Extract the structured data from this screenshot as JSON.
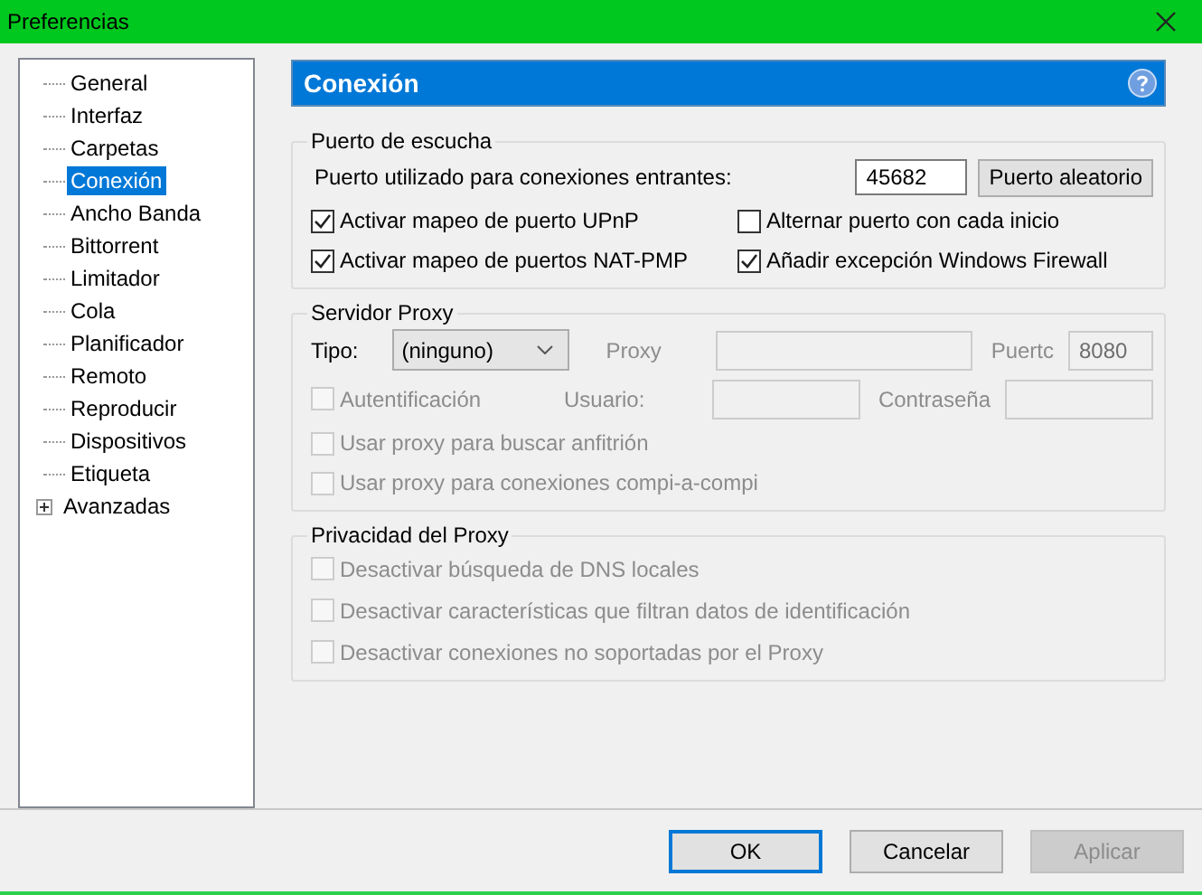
{
  "window": {
    "title": "Preferencias"
  },
  "tree": [
    {
      "label": "General",
      "selected": false,
      "expandable": false
    },
    {
      "label": "Interfaz",
      "selected": false,
      "expandable": false
    },
    {
      "label": "Carpetas",
      "selected": false,
      "expandable": false
    },
    {
      "label": "Conexión",
      "selected": true,
      "expandable": false
    },
    {
      "label": "Ancho Banda",
      "selected": false,
      "expandable": false
    },
    {
      "label": "Bittorrent",
      "selected": false,
      "expandable": false
    },
    {
      "label": "Limitador",
      "selected": false,
      "expandable": false
    },
    {
      "label": "Cola",
      "selected": false,
      "expandable": false
    },
    {
      "label": "Planificador",
      "selected": false,
      "expandable": false
    },
    {
      "label": "Remoto",
      "selected": false,
      "expandable": false
    },
    {
      "label": "Reproducir",
      "selected": false,
      "expandable": false
    },
    {
      "label": "Dispositivos",
      "selected": false,
      "expandable": false
    },
    {
      "label": "Etiqueta",
      "selected": false,
      "expandable": false
    },
    {
      "label": "Avanzadas",
      "selected": false,
      "expandable": true
    }
  ],
  "panel": {
    "title": "Conexión"
  },
  "listen": {
    "title": "Puerto de escucha",
    "port_label": "Puerto utilizado para conexiones entrantes:",
    "port": "45682",
    "random_button": "Puerto aleatorio",
    "options": [
      {
        "label": "Activar mapeo de puerto UPnP",
        "checked": true,
        "disabled": false
      },
      {
        "label": "Alternar puerto con cada inicio",
        "checked": false,
        "disabled": false
      },
      {
        "label": "Activar mapeo de puertos NAT-PMP",
        "checked": true,
        "disabled": false
      },
      {
        "label": "Añadir excepción Windows Firewall",
        "checked": true,
        "disabled": false
      }
    ]
  },
  "proxy": {
    "title": "Servidor Proxy",
    "type_label": "Tipo:",
    "type": "(ninguno)",
    "host_label": "Proxy",
    "port_label": "Puertc",
    "port": "8080",
    "fields_disabled": true,
    "auth": {
      "label": "Autentificación",
      "checked": false,
      "disabled": true
    },
    "user_label": "Usuario:",
    "password_label": "Contraseña",
    "options": [
      {
        "label": "Usar proxy para buscar anfitrión",
        "checked": false,
        "disabled": true
      },
      {
        "label": "Usar proxy para conexiones compi-a-compi",
        "checked": false,
        "disabled": true
      }
    ]
  },
  "privacy": {
    "title": "Privacidad del Proxy",
    "options": [
      {
        "label": "Desactivar búsqueda de DNS locales",
        "checked": false,
        "disabled": true
      },
      {
        "label": "Desactivar características que filtran datos de identificación",
        "checked": false,
        "disabled": true
      },
      {
        "label": "Desactivar conexiones no soportadas por el Proxy",
        "checked": false,
        "disabled": true
      }
    ]
  },
  "buttons": [
    {
      "label": "OK",
      "default": true,
      "disabled": false
    },
    {
      "label": "Cancelar",
      "default": false,
      "disabled": false
    },
    {
      "label": "Aplicar",
      "default": false,
      "disabled": true
    }
  ]
}
